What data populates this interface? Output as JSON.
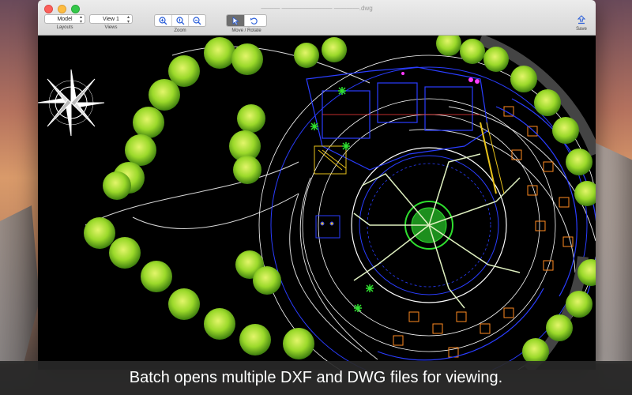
{
  "window": {
    "title": "———  ————————  ————.dwg"
  },
  "toolbar": {
    "layouts": {
      "value": "Model",
      "caption": "Layouts"
    },
    "views": {
      "value": "View 1",
      "caption": "Views"
    },
    "zoom": {
      "caption": "Zoom",
      "buttons": [
        "zoom-in-icon",
        "zoom-fit-icon",
        "zoom-out-icon"
      ]
    },
    "move_rotate": {
      "caption": "Move / Rotate",
      "buttons": [
        "pointer-icon",
        "rotate-icon"
      ]
    },
    "save": {
      "caption": "Save"
    }
  },
  "caption": {
    "text": "Batch opens multiple DXF and DWG files for viewing."
  },
  "colors": {
    "drawing_bg": "#000000",
    "tree_green": "#8fce2a",
    "cad_blue": "#2a3dff",
    "cad_yellow": "#e8c21a",
    "cad_orange": "#ff8a1f",
    "cad_green": "#2fe02f"
  }
}
